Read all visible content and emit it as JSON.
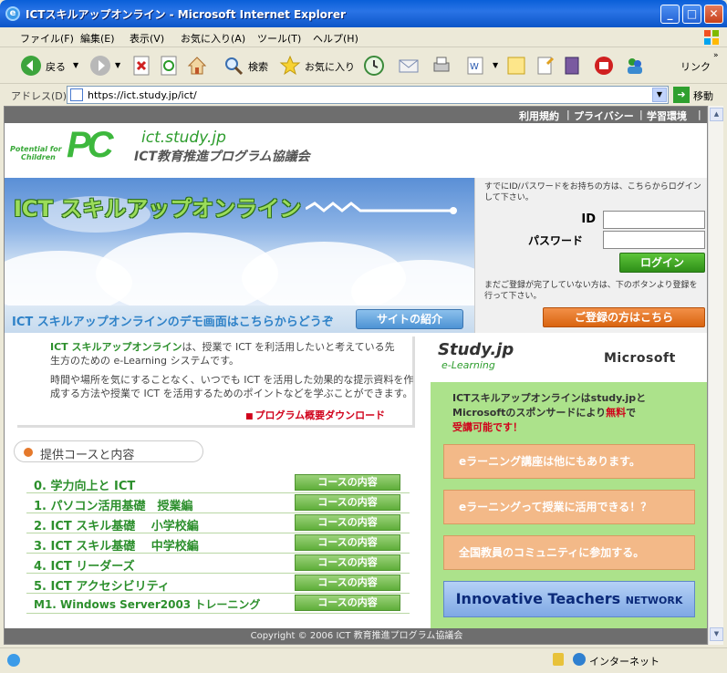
{
  "window": {
    "title": "ICTスキルアップオンライン - Microsoft Internet Explorer",
    "controls": {
      "minimize": "_",
      "maximize": "□",
      "close": "✕"
    }
  },
  "menu": [
    "ファイル(F)",
    "編集(E)",
    "表示(V)",
    "お気に入り(A)",
    "ツール(T)",
    "ヘルプ(H)"
  ],
  "toolbar": {
    "back_label": "戻る",
    "search_label": "検索",
    "favorites_label": "お気に入り",
    "links_label": "リンク"
  },
  "address": {
    "label": "アドレス(D)",
    "url": "https://ict.study.jp/ict/",
    "go_label": "移動"
  },
  "page": {
    "top_links": [
      "利用規約",
      "プライバシー",
      "学習環境"
    ],
    "logo": {
      "tagline_1": "Potential for",
      "tagline_2": "Children",
      "mark": "PC",
      "site": "ict.study.jp",
      "org": "ICT教育推進プログラム協議会"
    },
    "hero_title": "ICT スキルアップオンライン",
    "demo_text": "ICT スキルアップオンラインのデモ画面はこちらからどうぞ",
    "site_intro_button": "サイトの紹介",
    "login": {
      "note": "すでにID/パスワードをお持ちの方は、こちらからログインして下さい。",
      "id_label": "ID",
      "password_label": "パスワード",
      "id_value": "",
      "password_value": "",
      "login_button": "ログイン",
      "register_note": "まだご登録が完了していない方は、下のボタンより登録を行って下さい。",
      "register_button": "ご登録の方はこちら"
    },
    "intro": {
      "name": "ICT スキルアップオンライン",
      "p1_rest": "は、授業で ICT を利活用したいと考えている先生方のための e-Learning システムです。",
      "p2": "時間や場所を気にすることなく、いつでも ICT を活用した効果的な提示資料を作成する方法や授業で ICT を活用するためのポイントなどを学ぶことができます。",
      "download_link": "プログラム概要ダウンロード"
    },
    "courses_heading": "提供コースと内容",
    "courses": [
      {
        "name": "0.  学力向上と ICT",
        "button": "コースの内容"
      },
      {
        "name": "1.  パソコン活用基礎　授業編",
        "button": "コースの内容"
      },
      {
        "name": "2.  ICT スキル基礎　 小学校編",
        "button": "コースの内容"
      },
      {
        "name": "3.  ICT スキル基礎　 中学校編",
        "button": "コースの内容"
      },
      {
        "name": "4.  ICT リーダーズ",
        "button": "コースの内容"
      },
      {
        "name": "5.  ICT アクセシビリティ",
        "button": "コースの内容"
      },
      {
        "name": "M1. Windows Server2003 トレーニング",
        "button": "コースの内容"
      }
    ],
    "sponsor": {
      "studyjp": "Study.jp",
      "elearning": "e-Learning",
      "microsoft": "Microsoft"
    },
    "promo": {
      "line1": "ICTスキルアップオンラインはstudy.jpと",
      "line2a": "Microsoftのスポンサードにより",
      "free": "無料",
      "line2b": "で",
      "line3": "受講可能です！",
      "buttons": [
        "eラーニング講座は他にもあります。",
        "eラーニングって授業に活用できる！？",
        "全国教員のコミュニティに参加する。"
      ],
      "itn_main": "Innovative Teachers",
      "itn_sub": "NETWORK"
    },
    "footer": "Copyright © 2006 ICT 教育推進プログラム協議会"
  },
  "status": {
    "zone": "インターネット"
  },
  "colors": {
    "titlebar": "#0a5fd8",
    "green": "#2c8f2c",
    "login_button": "#3aa524",
    "register_button": "#e77a2a",
    "promo_bg": "#ace28b"
  }
}
